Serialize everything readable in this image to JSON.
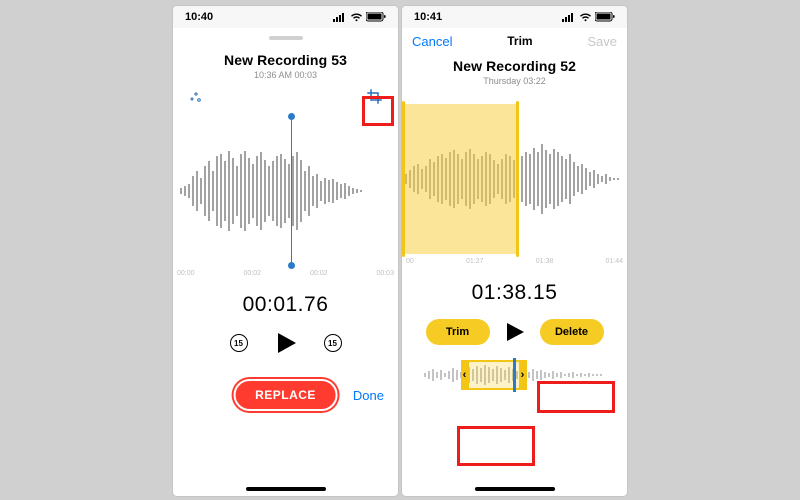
{
  "left": {
    "status_time": "10:40",
    "title": "New Recording 53",
    "subtitle": "10:36 AM  00:03",
    "timeline": [
      "00:00",
      "00:02",
      "00:03"
    ],
    "bigtime": "00:01.76",
    "skip_seconds": "15",
    "replace_label": "REPLACE",
    "done_label": "Done",
    "enhance_icon": "sparkle-icon",
    "trim_icon": "crop-icon"
  },
  "right": {
    "status_time": "10:41",
    "nav_cancel": "Cancel",
    "nav_title": "Trim",
    "nav_save": "Save",
    "title": "New Recording 52",
    "subtitle": "Thursday  03:22",
    "timeline": [
      "00",
      "01:27",
      "01:38",
      "01:44"
    ],
    "bigtime": "01:38.15",
    "trim_label": "Trim",
    "delete_label": "Delete"
  },
  "colors": {
    "accent_blue": "#0079ff",
    "accent_yellow": "#f6cc24",
    "accent_red": "#ff3b30",
    "highlight_red": "#ef1c1c"
  }
}
